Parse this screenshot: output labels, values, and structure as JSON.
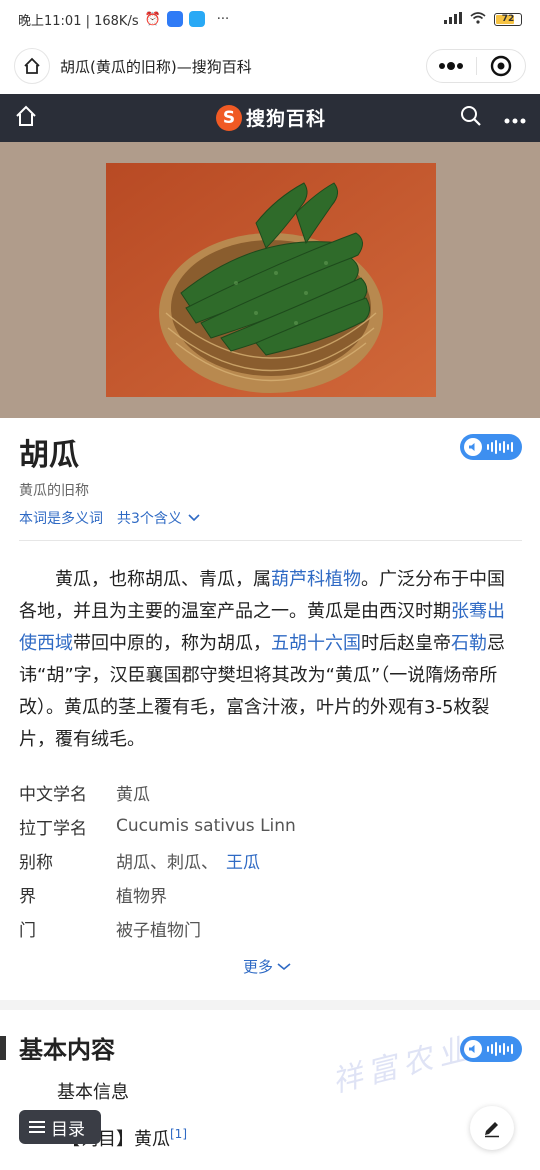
{
  "status_bar": {
    "time_speed": "晚上11:01 | 168K/s",
    "battery": "72"
  },
  "title_bar": {
    "title": "胡瓜(黄瓜的旧称)—搜狗百科"
  },
  "nav": {
    "logo_letter": "S",
    "logo_text": "搜狗百科"
  },
  "article": {
    "title": "胡瓜",
    "subtitle": "黄瓜的旧称",
    "polysemy_label": "本词是多义词",
    "meanings_label": "共3个含义",
    "summary": {
      "p1": "黄瓜，也称胡瓜、青瓜，属",
      "link1": "葫芦科植物",
      "p2": "。广泛分布于中国各地，并且为主要的温室产品之一。黄瓜是由西汉时期",
      "link2": "张骞出使西域",
      "p3": "带回中原的，称为胡瓜，",
      "link3": "五胡十六国",
      "p4": "时后赵皇帝",
      "link4": "石勒",
      "p5": "忌讳“胡”字，汉臣襄国郡守樊坦将其改为“黄瓜”（一说隋炀帝所改）。黄瓜的茎上覆有毛，富含汁液，叶片的外观有3-5枚裂片，覆有绒毛。"
    },
    "infobox": [
      {
        "key": "中文学名",
        "value": "黄瓜"
      },
      {
        "key": "拉丁学名",
        "value": "Cucumis sativus Linn"
      },
      {
        "key": "别称",
        "value": "胡瓜、刺瓜、",
        "link": "王瓜"
      },
      {
        "key": "界",
        "value": "植物界"
      },
      {
        "key": "门",
        "value": "被子植物门"
      }
    ],
    "more_label": "更多"
  },
  "section": {
    "title": "基本内容",
    "basic_info": "基本信息",
    "entry_prefix": "【词目】黄瓜",
    "entry_ref": "[1]",
    "watermark": "祥富农业"
  },
  "toc_button": "目录",
  "colors": {
    "nav_bg": "#2a2e38",
    "link": "#2f6ac4",
    "accent_orange": "#f05a24",
    "audio_blue": "#3d8ff0"
  }
}
